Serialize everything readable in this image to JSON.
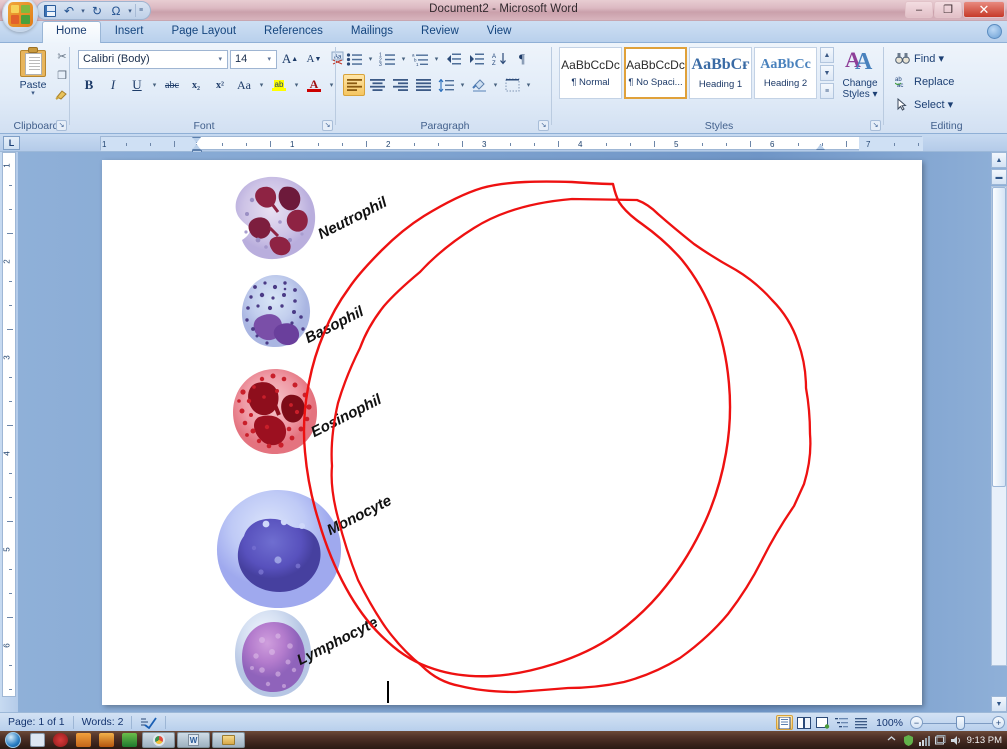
{
  "window": {
    "title": "Document2 - Microsoft Word",
    "minimize_label": "–",
    "maximize_label": "❐",
    "close_label": "✕"
  },
  "quick_access": {
    "save_tip": "Save",
    "undo_tip": "Undo",
    "redo_tip": "Redo",
    "symbol_glyph": "Ω",
    "undo_glyph": "↶",
    "redo_glyph": "↻",
    "customize_glyph": "≡",
    "dropdown_glyph": "▾"
  },
  "tabs": [
    {
      "label": "Home",
      "active": true
    },
    {
      "label": "Insert",
      "active": false
    },
    {
      "label": "Page Layout",
      "active": false
    },
    {
      "label": "References",
      "active": false
    },
    {
      "label": "Mailings",
      "active": false
    },
    {
      "label": "Review",
      "active": false
    },
    {
      "label": "View",
      "active": false
    }
  ],
  "ribbon": {
    "clipboard": {
      "group_label": "Clipboard",
      "paste_label": "Paste",
      "paste_arrow": "▾",
      "cut_glyph": "✂",
      "copy_glyph": "❐",
      "format_painter_glyph": "🖌",
      "launcher_glyph": "↘"
    },
    "font": {
      "group_label": "Font",
      "font_name": "Calibri (Body)",
      "font_size": "14",
      "grow_font": "A",
      "shrink_font": "A",
      "clear_formatting": "Aa",
      "bold": "B",
      "italic": "I",
      "underline": "U",
      "strikethrough": "abc",
      "subscript": "x₂",
      "superscript": "x²",
      "change_case": "Aa",
      "highlight": "ab",
      "font_color": "A",
      "dropdown_glyph": "▾",
      "launcher_glyph": "↘"
    },
    "paragraph": {
      "group_label": "Paragraph",
      "bullets": "bullets",
      "numbering": "numbering",
      "multilevel": "multilevel-list",
      "decrease_indent": "decrease-indent",
      "increase_indent": "increase-indent",
      "sort": "A\nZ↓",
      "show_marks": "¶",
      "align_left": "align-left",
      "align_center": "align-center",
      "align_right": "align-right",
      "justify": "justify",
      "line_spacing": "line-spacing",
      "shading": "shading",
      "borders": "borders",
      "dropdown_glyph": "▾",
      "launcher_glyph": "↘"
    },
    "styles": {
      "group_label": "Styles",
      "items": [
        {
          "preview": "AaBbCcDc",
          "name": "¶ Normal",
          "selected": false,
          "kind": "body"
        },
        {
          "preview": "AaBbCcDc",
          "name": "¶ No Spaci...",
          "selected": true,
          "kind": "body"
        },
        {
          "preview": "AaBbCғ",
          "name": "Heading 1",
          "selected": false,
          "kind": "h1"
        },
        {
          "preview": "AaBbCc",
          "name": "Heading 2",
          "selected": false,
          "kind": "h2"
        }
      ],
      "change_styles_line1": "Change",
      "change_styles_line2": "Styles ▾",
      "scroll_up": "▲",
      "scroll_mid": "▼",
      "scroll_more": "≡",
      "launcher_glyph": "↘"
    },
    "editing": {
      "group_label": "Editing",
      "find": "Find ▾",
      "replace": "Replace",
      "select": "Select ▾",
      "find_icon": "🔍",
      "replace_icon": "ab",
      "select_icon": "➤"
    }
  },
  "ruler": {
    "corner_tab_label": "L",
    "h_marks": [
      "1",
      "1",
      "2",
      "3",
      "4",
      "5",
      "6",
      "7"
    ],
    "v_marks": [
      "1",
      "2",
      "3",
      "4",
      "5",
      "6"
    ]
  },
  "document": {
    "cells": [
      {
        "label": "Neutrophil"
      },
      {
        "label": "Basophil"
      },
      {
        "label": "Eosinophil"
      },
      {
        "label": "Monocyte"
      },
      {
        "label": "Lymphocyte"
      }
    ],
    "annotation": {
      "name": "red-hand-drawn-circle",
      "color": "#ee1111"
    }
  },
  "status_bar": {
    "page": "Page: 1 of 1",
    "words": "Words: 2",
    "proofing_icon": "spelling-check-icon",
    "view_buttons": [
      {
        "name": "print-layout",
        "active": true
      },
      {
        "name": "full-screen-reading",
        "active": false
      },
      {
        "name": "web-layout",
        "active": false
      },
      {
        "name": "outline",
        "active": false
      },
      {
        "name": "draft",
        "active": false
      }
    ],
    "zoom": "100%",
    "zoom_out": "−",
    "zoom_in": "+"
  },
  "taskbar": {
    "start_label": "Start",
    "clock": "9:13 PM",
    "items": [
      {
        "name": "media-player"
      },
      {
        "name": "opera"
      },
      {
        "name": "adobe-reader"
      },
      {
        "name": "adobe-app"
      },
      {
        "name": "excel"
      },
      {
        "name": "chrome-window"
      },
      {
        "name": "word-window"
      },
      {
        "name": "explorer-window"
      }
    ]
  },
  "colors": {
    "accent": "#1b3f75",
    "annotation_red": "#ee1111",
    "title_bar": "#d8b4bd",
    "ribbon_bg": "#e2ecf8"
  }
}
